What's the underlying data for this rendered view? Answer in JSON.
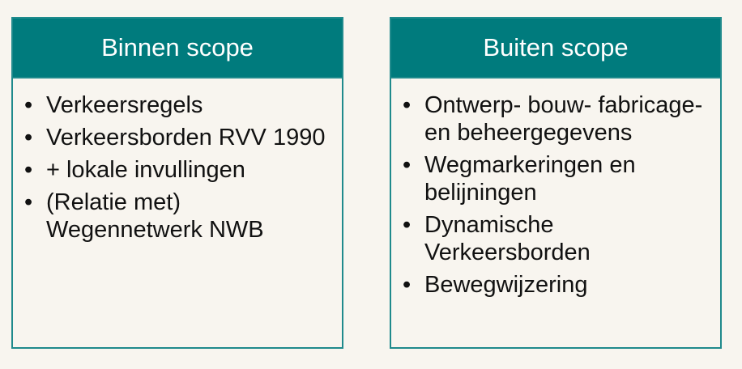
{
  "panels": [
    {
      "title": "Binnen scope",
      "items": [
        "Verkeersregels",
        "Verkeersborden RVV 1990",
        "+ lokale invullingen",
        "(Relatie met) Wegennetwerk NWB"
      ]
    },
    {
      "title": "Buiten scope",
      "items": [
        "Ontwerp- bouw- fabricage- en beheergegevens",
        "Wegmarkeringen en belijningen",
        "Dynamische Verkeersborden",
        "Bewegwijzering"
      ]
    }
  ],
  "bullet_glyph": "•",
  "colors": {
    "header_fill": "#007b7d",
    "border": "#1f8a8c",
    "background": "#f8f5ef"
  }
}
